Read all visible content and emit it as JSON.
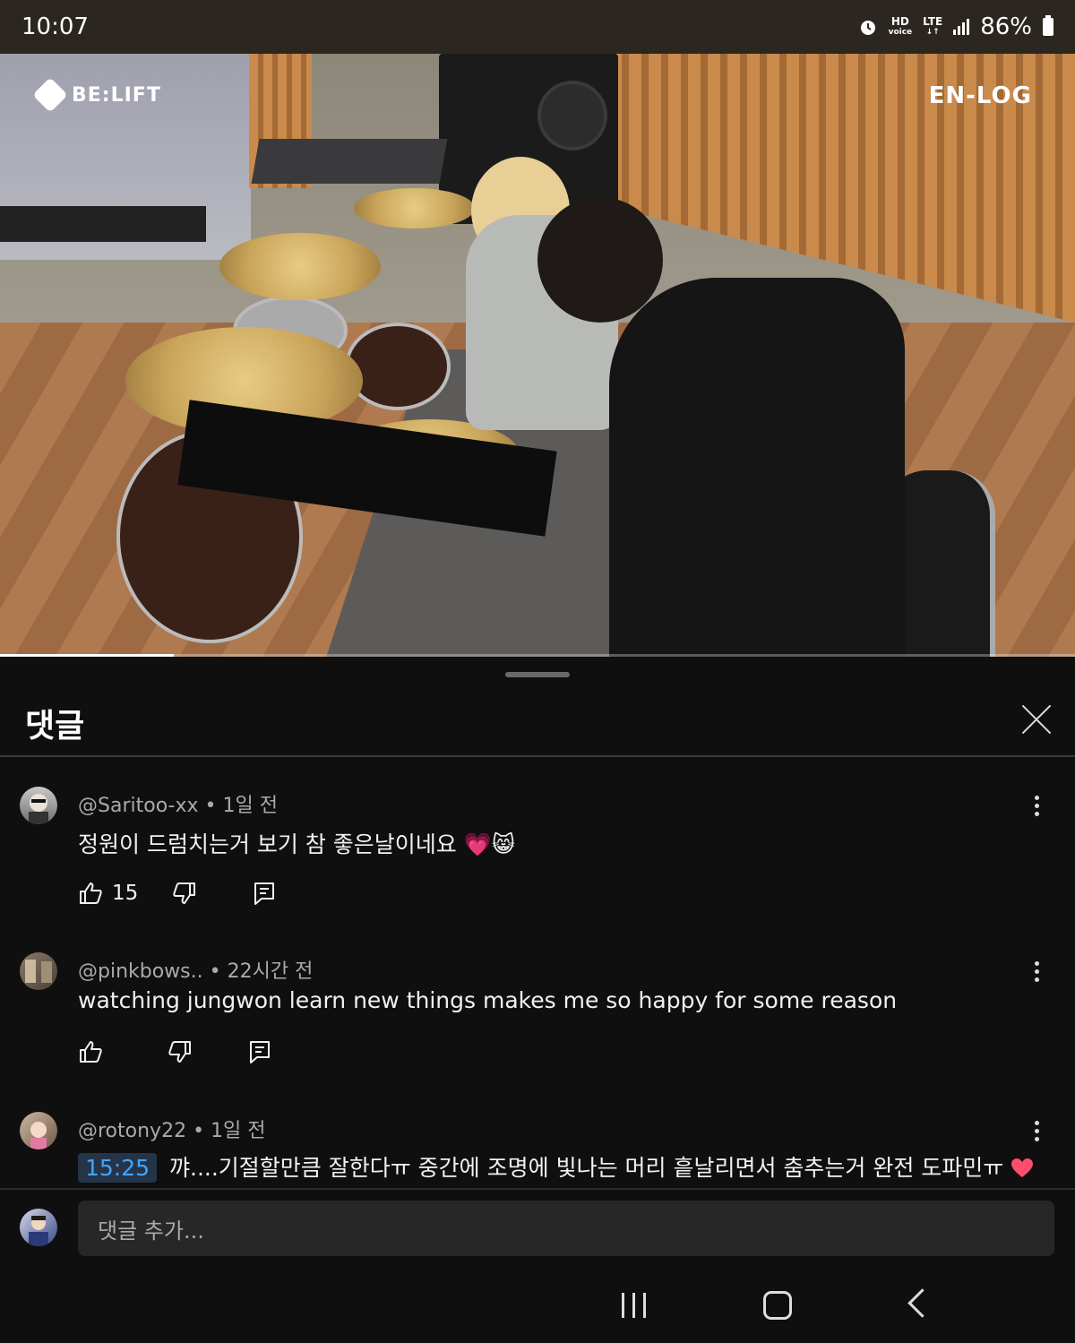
{
  "status_bar": {
    "time": "10:07",
    "hd_top": "HD",
    "hd_bottom": "voice",
    "lte": "LTE",
    "battery": "86%"
  },
  "video": {
    "logo_left": "BE:LIFT",
    "logo_right": "EN-LOG",
    "progress_fraction": 0.162
  },
  "comments_panel": {
    "title": "댓글",
    "comments": [
      {
        "author": "@Saritoo-xx",
        "age": "1일 전",
        "text": "정원이 드럼치는거 보기 참 좋은날이네요 💗😸",
        "likes": "15"
      },
      {
        "author": "@pinkbows..",
        "age": "22시간 전",
        "text": "watching jungwon learn new things makes me so happy for some reason",
        "likes": ""
      },
      {
        "author": "@rotony22",
        "age": "1일 전",
        "timestamp": "15:25",
        "text": " 꺄....기절할만큼 잘한다ㅠ 중간에 조명에 빛나는 머리 흩날리면서 춤추는거 완전 도파민ㅠ",
        "likes": ""
      }
    ],
    "add_comment_placeholder": "댓글 추가..."
  },
  "icons": {
    "like": "thumbs-up-icon",
    "dislike": "thumbs-down-icon",
    "reply": "reply-icon",
    "more": "kebab-menu-icon",
    "close": "close-icon"
  },
  "colors": {
    "background": "#0f0f0f",
    "link_timestamp": "#3ea6ff"
  }
}
